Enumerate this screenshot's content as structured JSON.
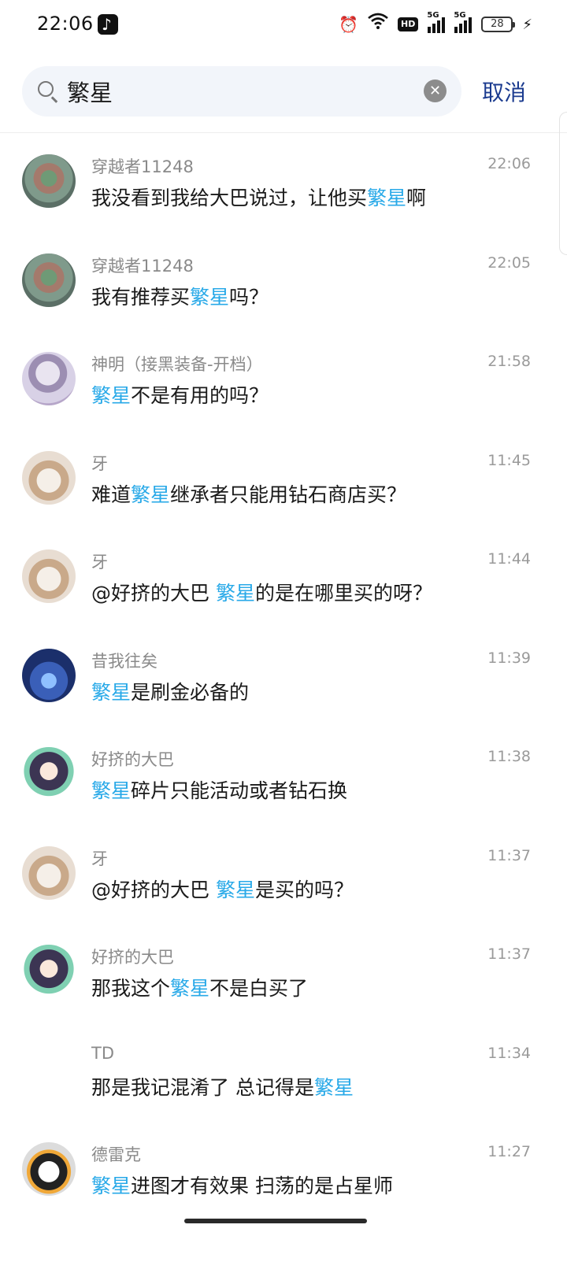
{
  "status_bar": {
    "time": "22:06",
    "battery": "28",
    "net1": "5G",
    "net2": "5G",
    "hd": "HD"
  },
  "search": {
    "query": "繁星",
    "cancel_label": "取消"
  },
  "results": [
    {
      "name": "穿越者11248",
      "time": "22:06",
      "avatar": "game-avatar",
      "pre": "我没看到我给大巴说过，让他买",
      "kw": "繁星",
      "post": "啊"
    },
    {
      "name": "穿越者11248",
      "time": "22:05",
      "avatar": "game-avatar",
      "pre": "我有推荐买",
      "kw": "繁星",
      "post": "吗？"
    },
    {
      "name": "神明（接黑装备-开档）",
      "time": "21:58",
      "avatar": "anime-avatar",
      "pre": "",
      "kw": "繁星",
      "post": "不是有用的吗？"
    },
    {
      "name": "牙",
      "time": "11:45",
      "avatar": "cat-avatar",
      "pre": "难道",
      "kw": "繁星",
      "post": "继承者只能用钻石商店买？"
    },
    {
      "name": "牙",
      "time": "11:44",
      "avatar": "cat-avatar",
      "pre": "@好挤的大巴  ",
      "kw": "繁星",
      "post": "的是在哪里买的呀？"
    },
    {
      "name": "昔我往矣",
      "time": "11:39",
      "avatar": "tree-avatar",
      "pre": "",
      "kw": "繁星",
      "post": "是刷金必备的"
    },
    {
      "name": "好挤的大巴",
      "time": "11:38",
      "avatar": "girl-avatar",
      "pre": "",
      "kw": "繁星",
      "post": "碎片只能活动或者钻石换"
    },
    {
      "name": "牙",
      "time": "11:37",
      "avatar": "cat-avatar",
      "pre": "@好挤的大巴  ",
      "kw": "繁星",
      "post": "是买的吗？"
    },
    {
      "name": "好挤的大巴",
      "time": "11:37",
      "avatar": "girl-avatar",
      "pre": "那我这个",
      "kw": "繁星",
      "post": "不是白买了"
    },
    {
      "name": "TD",
      "time": "11:34",
      "avatar": "",
      "pre": "那是我记混淆了  总记得是",
      "kw": "繁星",
      "post": ""
    },
    {
      "name": "德雷克",
      "time": "11:27",
      "avatar": "penguin-avatar",
      "pre": "",
      "kw": "繁星",
      "post": "进图才有效果 扫荡的是占星师"
    }
  ],
  "colors": {
    "highlight": "#28a9e8",
    "cancel": "#1b3b8f",
    "name": "#8a8a8a"
  }
}
